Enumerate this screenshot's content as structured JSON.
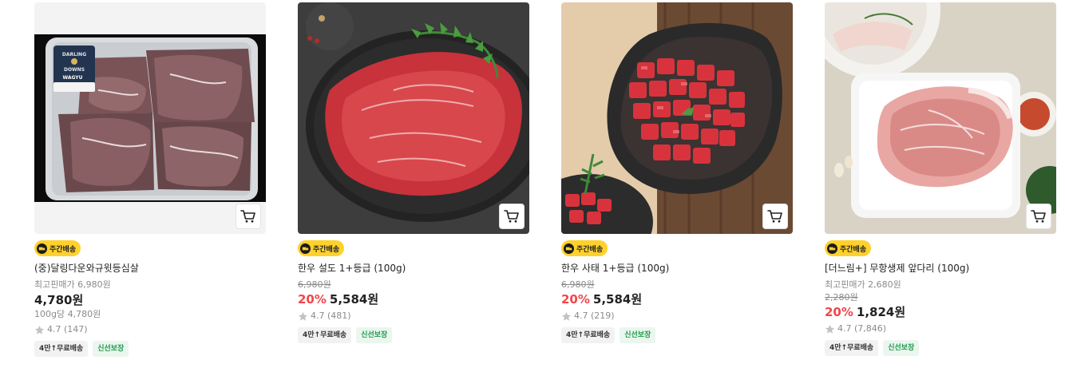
{
  "products": [
    {
      "badge": "주간배송",
      "name": "(중)달링다운와규윗등심살",
      "max_discount_price_text": "최고핀매가 6,980원",
      "original_price": "",
      "discount": "",
      "price": "4,780원",
      "unit_price": "100g당 4,780원",
      "rating": "4.7",
      "reviews": "(147)",
      "tags": [
        "4만↑무료배송",
        "신선보장"
      ],
      "package_label": {
        "line1": "DARLING",
        "line2": "DOWNS",
        "line3": "WAGYU"
      }
    },
    {
      "badge": "주간배송",
      "name": "한우 설도 1+등급 (100g)",
      "max_discount_price_text": "",
      "original_price": "6,980원",
      "discount": "20%",
      "price": "5,584원",
      "unit_price": "",
      "rating": "4.7",
      "reviews": "(481)",
      "tags": [
        "4만↑무료배송",
        "신선보장"
      ]
    },
    {
      "badge": "주간배송",
      "name": "한우 사태 1+등급 (100g)",
      "max_discount_price_text": "",
      "original_price": "6,980원",
      "discount": "20%",
      "price": "5,584원",
      "unit_price": "",
      "rating": "4.7",
      "reviews": "(219)",
      "tags": [
        "4만↑무료배송",
        "신선보장"
      ]
    },
    {
      "badge": "주간배송",
      "name": "[더느림+] 무항생제 앞다리 (100g)",
      "max_discount_price_text": "최고핀매가 2,680원",
      "original_price": "2,280원",
      "discount": "20%",
      "price": "1,824원",
      "unit_price": "",
      "rating": "4.7",
      "reviews": "(7,846)",
      "tags": [
        "4만↑무료배송",
        "신선보장"
      ]
    }
  ],
  "icons": {
    "cart": "cart-icon",
    "truck": "truck-icon",
    "star": "star-icon"
  },
  "colors": {
    "discount": "#f2464a",
    "badge": "#ffd12c",
    "fresh_tag_text": "#1f9b4c"
  }
}
